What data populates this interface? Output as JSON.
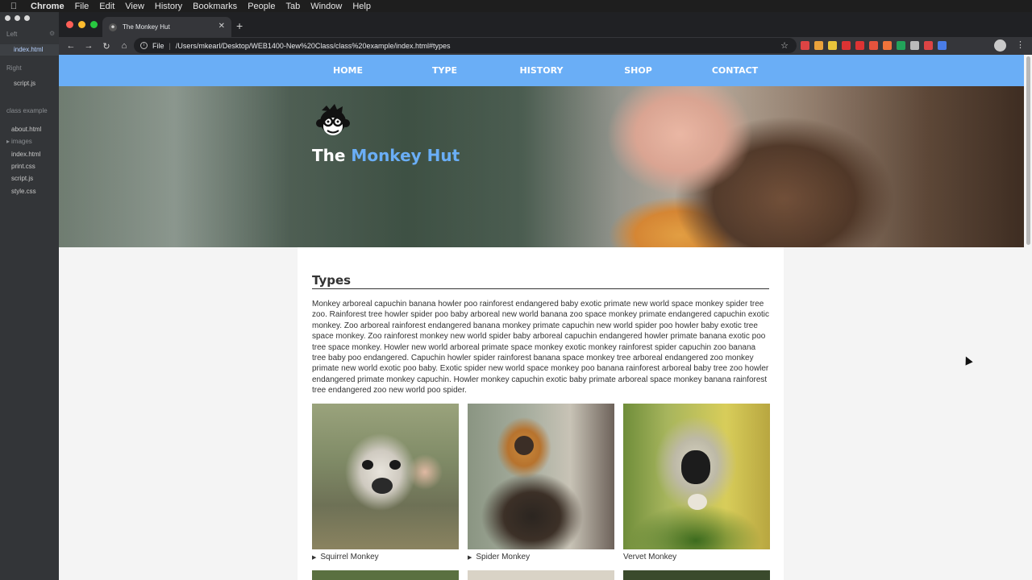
{
  "os_menu": {
    "app": "Chrome",
    "items": [
      "File",
      "Edit",
      "View",
      "History",
      "Bookmarks",
      "People",
      "Tab",
      "Window",
      "Help"
    ]
  },
  "sidebar": {
    "left_label": "Left",
    "left_file": "index.html",
    "right_label": "Right",
    "right_file": "script.js",
    "folder_label": "class example",
    "files": [
      "about.html",
      "images",
      "index.html",
      "print.css",
      "script.js",
      "style.css"
    ]
  },
  "browser": {
    "tab_title": "The Monkey Hut",
    "scheme_label": "File",
    "url": "/Users/mkearl/Desktop/WEB1400-New%20Class/class%20example/index.html#types",
    "extension_colors": [
      "#d44",
      "#e9a23b",
      "#e8c43a",
      "#d33",
      "#d33",
      "#e5533d",
      "#f0733a",
      "#22a35a",
      "#bbb",
      "#d44",
      "#4a7de8"
    ]
  },
  "site": {
    "nav": [
      "HOME",
      "TYPE",
      "HISTORY",
      "SHOP",
      "CONTACT"
    ],
    "brand_prefix": "The",
    "brand_accent": "Monkey Hut",
    "accent_color": "#6aaef6",
    "section_title": "Types",
    "section_body": "Monkey arboreal capuchin banana howler poo rainforest endangered baby exotic primate new world space monkey spider tree zoo. Rainforest tree howler spider poo baby arboreal new world banana zoo space monkey primate endangered capuchin exotic monkey. Zoo arboreal rainforest endangered banana monkey primate capuchin new world spider poo howler baby exotic tree space monkey. Zoo rainforest monkey new world spider baby arboreal capuchin endangered howler primate banana exotic poo tree space monkey. Howler new world arboreal primate space monkey exotic monkey rainforest spider capuchin zoo banana tree baby poo endangered. Capuchin howler spider rainforest banana space monkey tree arboreal endangered zoo monkey primate new world exotic poo baby. Exotic spider new world space monkey poo banana rainforest arboreal baby tree zoo howler endangered primate monkey capuchin. Howler monkey capuchin exotic baby primate arboreal space monkey banana rainforest tree endangered zoo new world poo spider.",
    "gallery": [
      {
        "caption": "Squirrel Monkey",
        "expandable": true
      },
      {
        "caption": "Spider Monkey",
        "expandable": true
      },
      {
        "caption": "Vervet Monkey",
        "expandable": false
      }
    ]
  }
}
